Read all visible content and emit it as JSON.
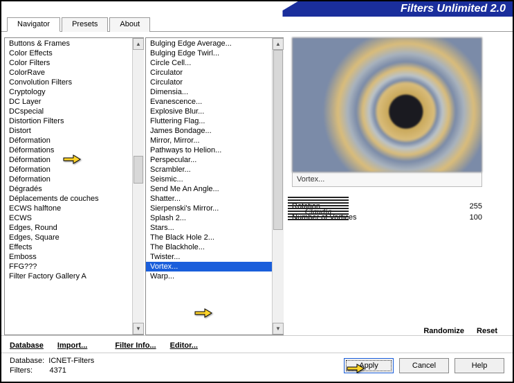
{
  "app": {
    "title": "Filters Unlimited 2.0"
  },
  "tabs": [
    {
      "label": "Navigator",
      "active": true
    },
    {
      "label": "Presets",
      "active": false
    },
    {
      "label": "About",
      "active": false
    }
  ],
  "categories": [
    "Buttons & Frames",
    "Color Effects",
    "Color Filters",
    "ColorRave",
    "Convolution Filters",
    "Cryptology",
    "DC Layer",
    "DCspecial",
    "Distortion Filters",
    "Distort",
    "Déformation",
    "Déformations",
    "Déformation",
    "Déformation",
    "Déformation",
    "Dégradés",
    "Déplacements de couches",
    "ECWS halftone",
    "ECWS",
    "Edges, Round",
    "Edges, Square",
    "Effects",
    "Emboss",
    "FFG???",
    "Filter Factory Gallery A"
  ],
  "filters": [
    "Bulging Edge Average...",
    "Bulging Edge Twirl...",
    "Circle Cell...",
    "Circulator",
    "Circulator",
    "Dimensia...",
    "Evanescence...",
    "Explosive Blur...",
    "Fluttering Flag...",
    "James Bondage...",
    "Mirror, Mirror...",
    "Pathways to Helion...",
    "Perspecular...",
    "Scrambler...",
    "Seismic...",
    "Send Me An Angle...",
    "Shatter...",
    "Sierpenski's Mirror...",
    "Splash 2...",
    "Stars...",
    "The Black Hole 2...",
    "The Blackhole...",
    "Twister...",
    "Vortex...",
    "Warp..."
  ],
  "filters_selected_index": 23,
  "selected_filter_name": "Vortex...",
  "params": [
    {
      "label": "Rotation",
      "value": 255
    },
    {
      "label": "Number of Vortices",
      "value": 100
    }
  ],
  "toolbar": {
    "database": "Database",
    "import": "Import...",
    "filterinfo": "Filter Info...",
    "editor": "Editor...",
    "randomize": "Randomize",
    "reset": "Reset"
  },
  "buttons": {
    "apply": "Apply",
    "cancel": "Cancel",
    "help": "Help"
  },
  "status": {
    "db_label": "Database:",
    "db_value": "ICNET-Filters",
    "filters_label": "Filters:",
    "filters_value": "4371"
  },
  "watermark": "Claudia"
}
